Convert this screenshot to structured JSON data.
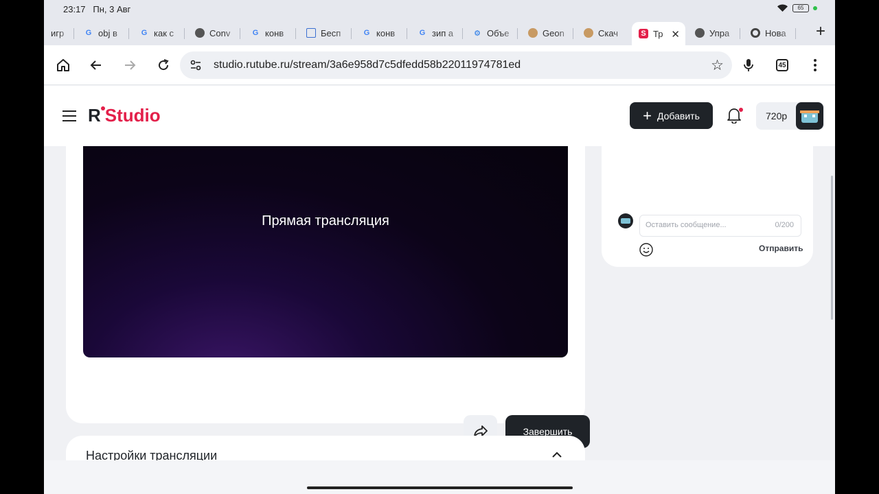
{
  "status": {
    "time": "23:17",
    "date": "Пн, 3 Авг",
    "battery": "65"
  },
  "tabs": [
    {
      "label": "игр",
      "icon": "generic"
    },
    {
      "label": "obj в",
      "icon": "google"
    },
    {
      "label": "как с",
      "icon": "google"
    },
    {
      "label": "Conv",
      "icon": "globe"
    },
    {
      "label": "конв",
      "icon": "google"
    },
    {
      "label": "Бесп",
      "icon": "grid"
    },
    {
      "label": "конв",
      "icon": "google"
    },
    {
      "label": "зип а",
      "icon": "google"
    },
    {
      "label": "Объе",
      "icon": "gear"
    },
    {
      "label": "Geon",
      "icon": "pug"
    },
    {
      "label": "Скач",
      "icon": "pug"
    },
    {
      "label": "Тр",
      "icon": "rutube",
      "active": true
    },
    {
      "label": "Упра",
      "icon": "globe"
    },
    {
      "label": "Нова",
      "icon": "chrome"
    }
  ],
  "toolbar": {
    "url": "studio.rutube.ru/stream/3a6e958d7c5dfedd58b22011974781ed",
    "tab_count": "45"
  },
  "header": {
    "logo_r": "R",
    "logo_studio": "Studio",
    "add_label": "Добавить",
    "quality": "720p"
  },
  "stream": {
    "title": "Прямая трансляция",
    "finish_label": "Завершить"
  },
  "settings": {
    "title": "Настройки трансляции"
  },
  "chat": {
    "placeholder": "Оставить сообщение...",
    "counter": "0/200",
    "send_label": "Отправить"
  }
}
